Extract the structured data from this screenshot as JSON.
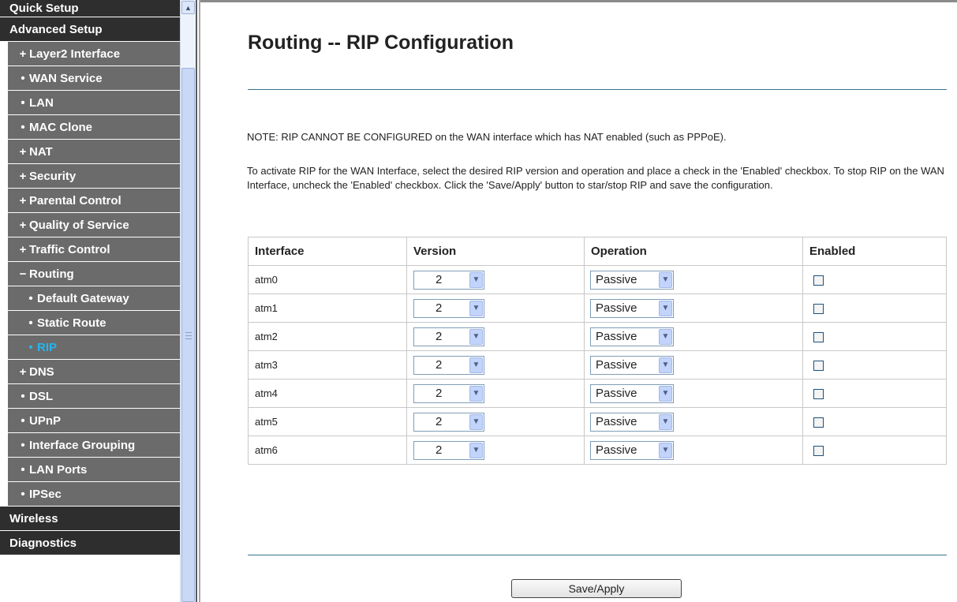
{
  "sidebar": {
    "items": [
      {
        "mark": "",
        "label": "Quick Setup"
      },
      {
        "mark": "",
        "label": "Advanced Setup"
      },
      {
        "mark": "+",
        "label": "Layer2 Interface"
      },
      {
        "mark": "•",
        "label": "WAN Service"
      },
      {
        "mark": "•",
        "label": "LAN"
      },
      {
        "mark": "•",
        "label": "MAC Clone"
      },
      {
        "mark": "+",
        "label": "NAT"
      },
      {
        "mark": "+",
        "label": "Security"
      },
      {
        "mark": "+",
        "label": "Parental Control"
      },
      {
        "mark": "+",
        "label": "Quality of Service"
      },
      {
        "mark": "+",
        "label": "Traffic Control"
      },
      {
        "mark": "−",
        "label": "Routing"
      },
      {
        "mark": "•",
        "label": "Default Gateway"
      },
      {
        "mark": "•",
        "label": "Static Route"
      },
      {
        "mark": "•",
        "label": "RIP"
      },
      {
        "mark": "+",
        "label": "DNS"
      },
      {
        "mark": "•",
        "label": "DSL"
      },
      {
        "mark": "•",
        "label": "UPnP"
      },
      {
        "mark": "•",
        "label": "Interface Grouping"
      },
      {
        "mark": "•",
        "label": "LAN Ports"
      },
      {
        "mark": "•",
        "label": "IPSec"
      },
      {
        "mark": "",
        "label": "Wireless"
      },
      {
        "mark": "",
        "label": "Diagnostics"
      }
    ],
    "scroll_up_glyph": "▲"
  },
  "main": {
    "title": "Routing -- RIP Configuration",
    "note1": "NOTE: RIP CANNOT BE CONFIGURED on the WAN interface which has NAT enabled (such as PPPoE).",
    "note2": "To activate RIP for the WAN Interface, select the desired RIP version and operation and place a check in the 'Enabled' checkbox. To stop RIP on the WAN Interface, uncheck the 'Enabled' checkbox. Click the 'Save/Apply' button to star/stop RIP and save the configuration.",
    "table": {
      "headers": [
        "Interface",
        "Version",
        "Operation",
        "Enabled"
      ],
      "rows": [
        {
          "interface": "atm0",
          "version": "2",
          "operation": "Passive",
          "enabled": false
        },
        {
          "interface": "atm1",
          "version": "2",
          "operation": "Passive",
          "enabled": false
        },
        {
          "interface": "atm2",
          "version": "2",
          "operation": "Passive",
          "enabled": false
        },
        {
          "interface": "atm3",
          "version": "2",
          "operation": "Passive",
          "enabled": false
        },
        {
          "interface": "atm4",
          "version": "2",
          "operation": "Passive",
          "enabled": false
        },
        {
          "interface": "atm5",
          "version": "2",
          "operation": "Passive",
          "enabled": false
        },
        {
          "interface": "atm6",
          "version": "2",
          "operation": "Passive",
          "enabled": false
        }
      ]
    },
    "save_label": "Save/Apply",
    "dropdown_arrow_glyph": "▼"
  },
  "colors": {
    "nav_dark": "#2e2e2e",
    "nav_sub": "#6b6b6b",
    "nav_active_text": "#26b5ef",
    "rule": "#37758f"
  }
}
